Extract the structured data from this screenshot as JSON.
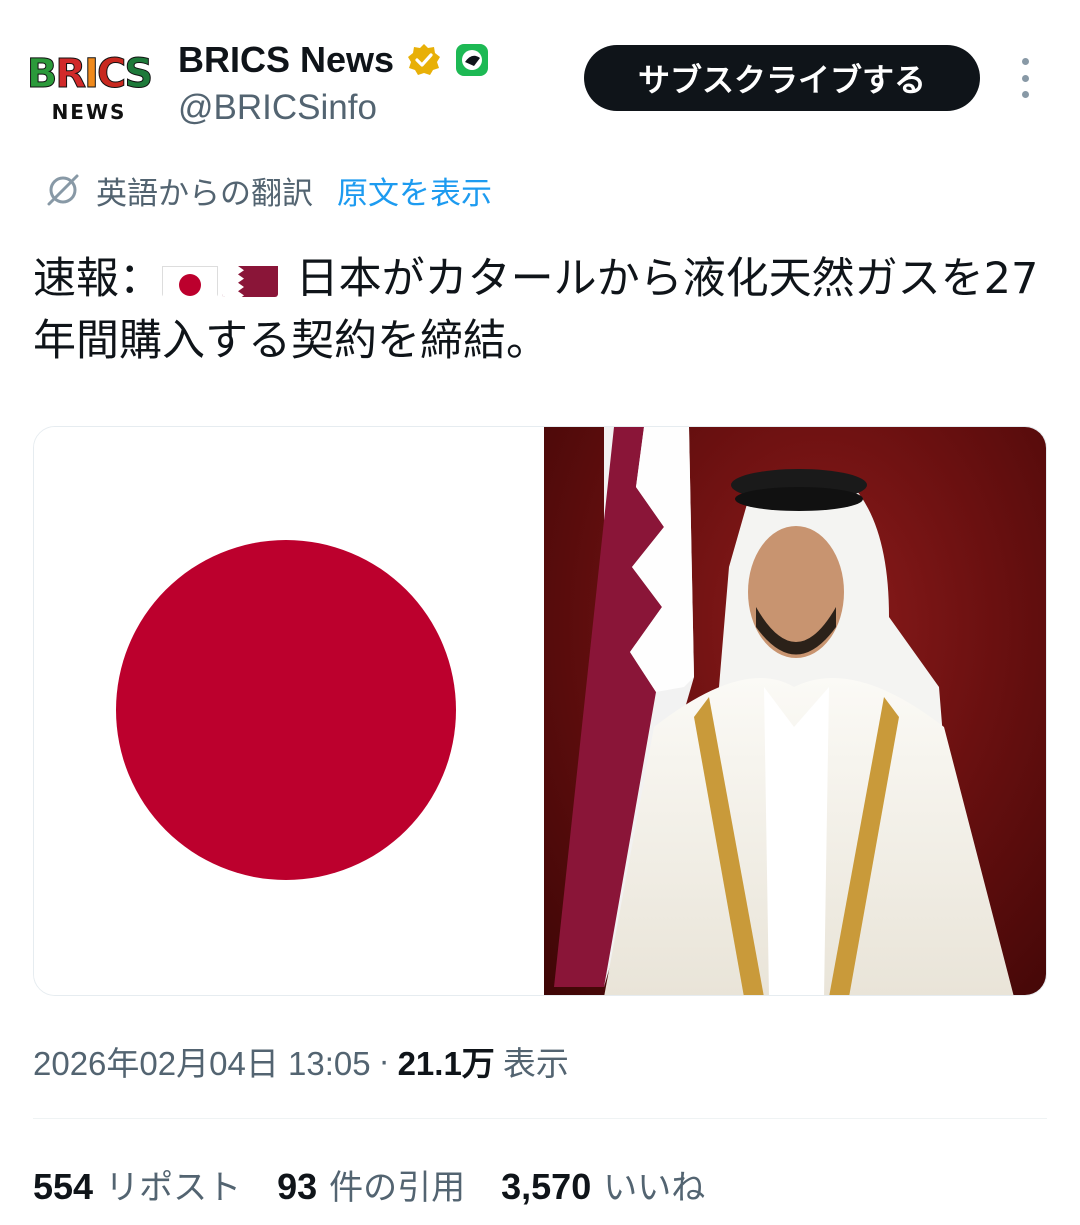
{
  "header": {
    "logo_top": [
      "B",
      "R",
      "I",
      "C",
      "S"
    ],
    "logo_bottom": "NEWS",
    "display_name": "BRICS News",
    "handle": "@BRICSinfo",
    "subscribe_label": "サブスクライブする"
  },
  "translation": {
    "label": "英語からの翻訳",
    "show_original": "原文を表示"
  },
  "tweet": {
    "text_prefix": "速報：",
    "text_body": " 日本がカタールから液化天然ガスを27年間購入する契約を締結。"
  },
  "meta": {
    "datetime": "2026年02月04日 13:05",
    "separator": "·",
    "views_count": "21.1万",
    "views_label": "表示"
  },
  "stats": {
    "reposts_count": "554",
    "reposts_label": "リポスト",
    "quotes_count": "93",
    "quotes_label": "件の引用",
    "likes_count": "3,570",
    "likes_label": "いいね"
  },
  "colors": {
    "accent": "#1d9bf0",
    "japan_red": "#bc002d",
    "qatar_maroon": "#8a1538",
    "verified_gold": "#e8b007",
    "badge_green": "#1db954"
  },
  "icons": {
    "verified": "verified-badge-icon",
    "affiliate": "affiliate-badge-icon",
    "translate": "translate-icon",
    "more": "more-icon"
  }
}
